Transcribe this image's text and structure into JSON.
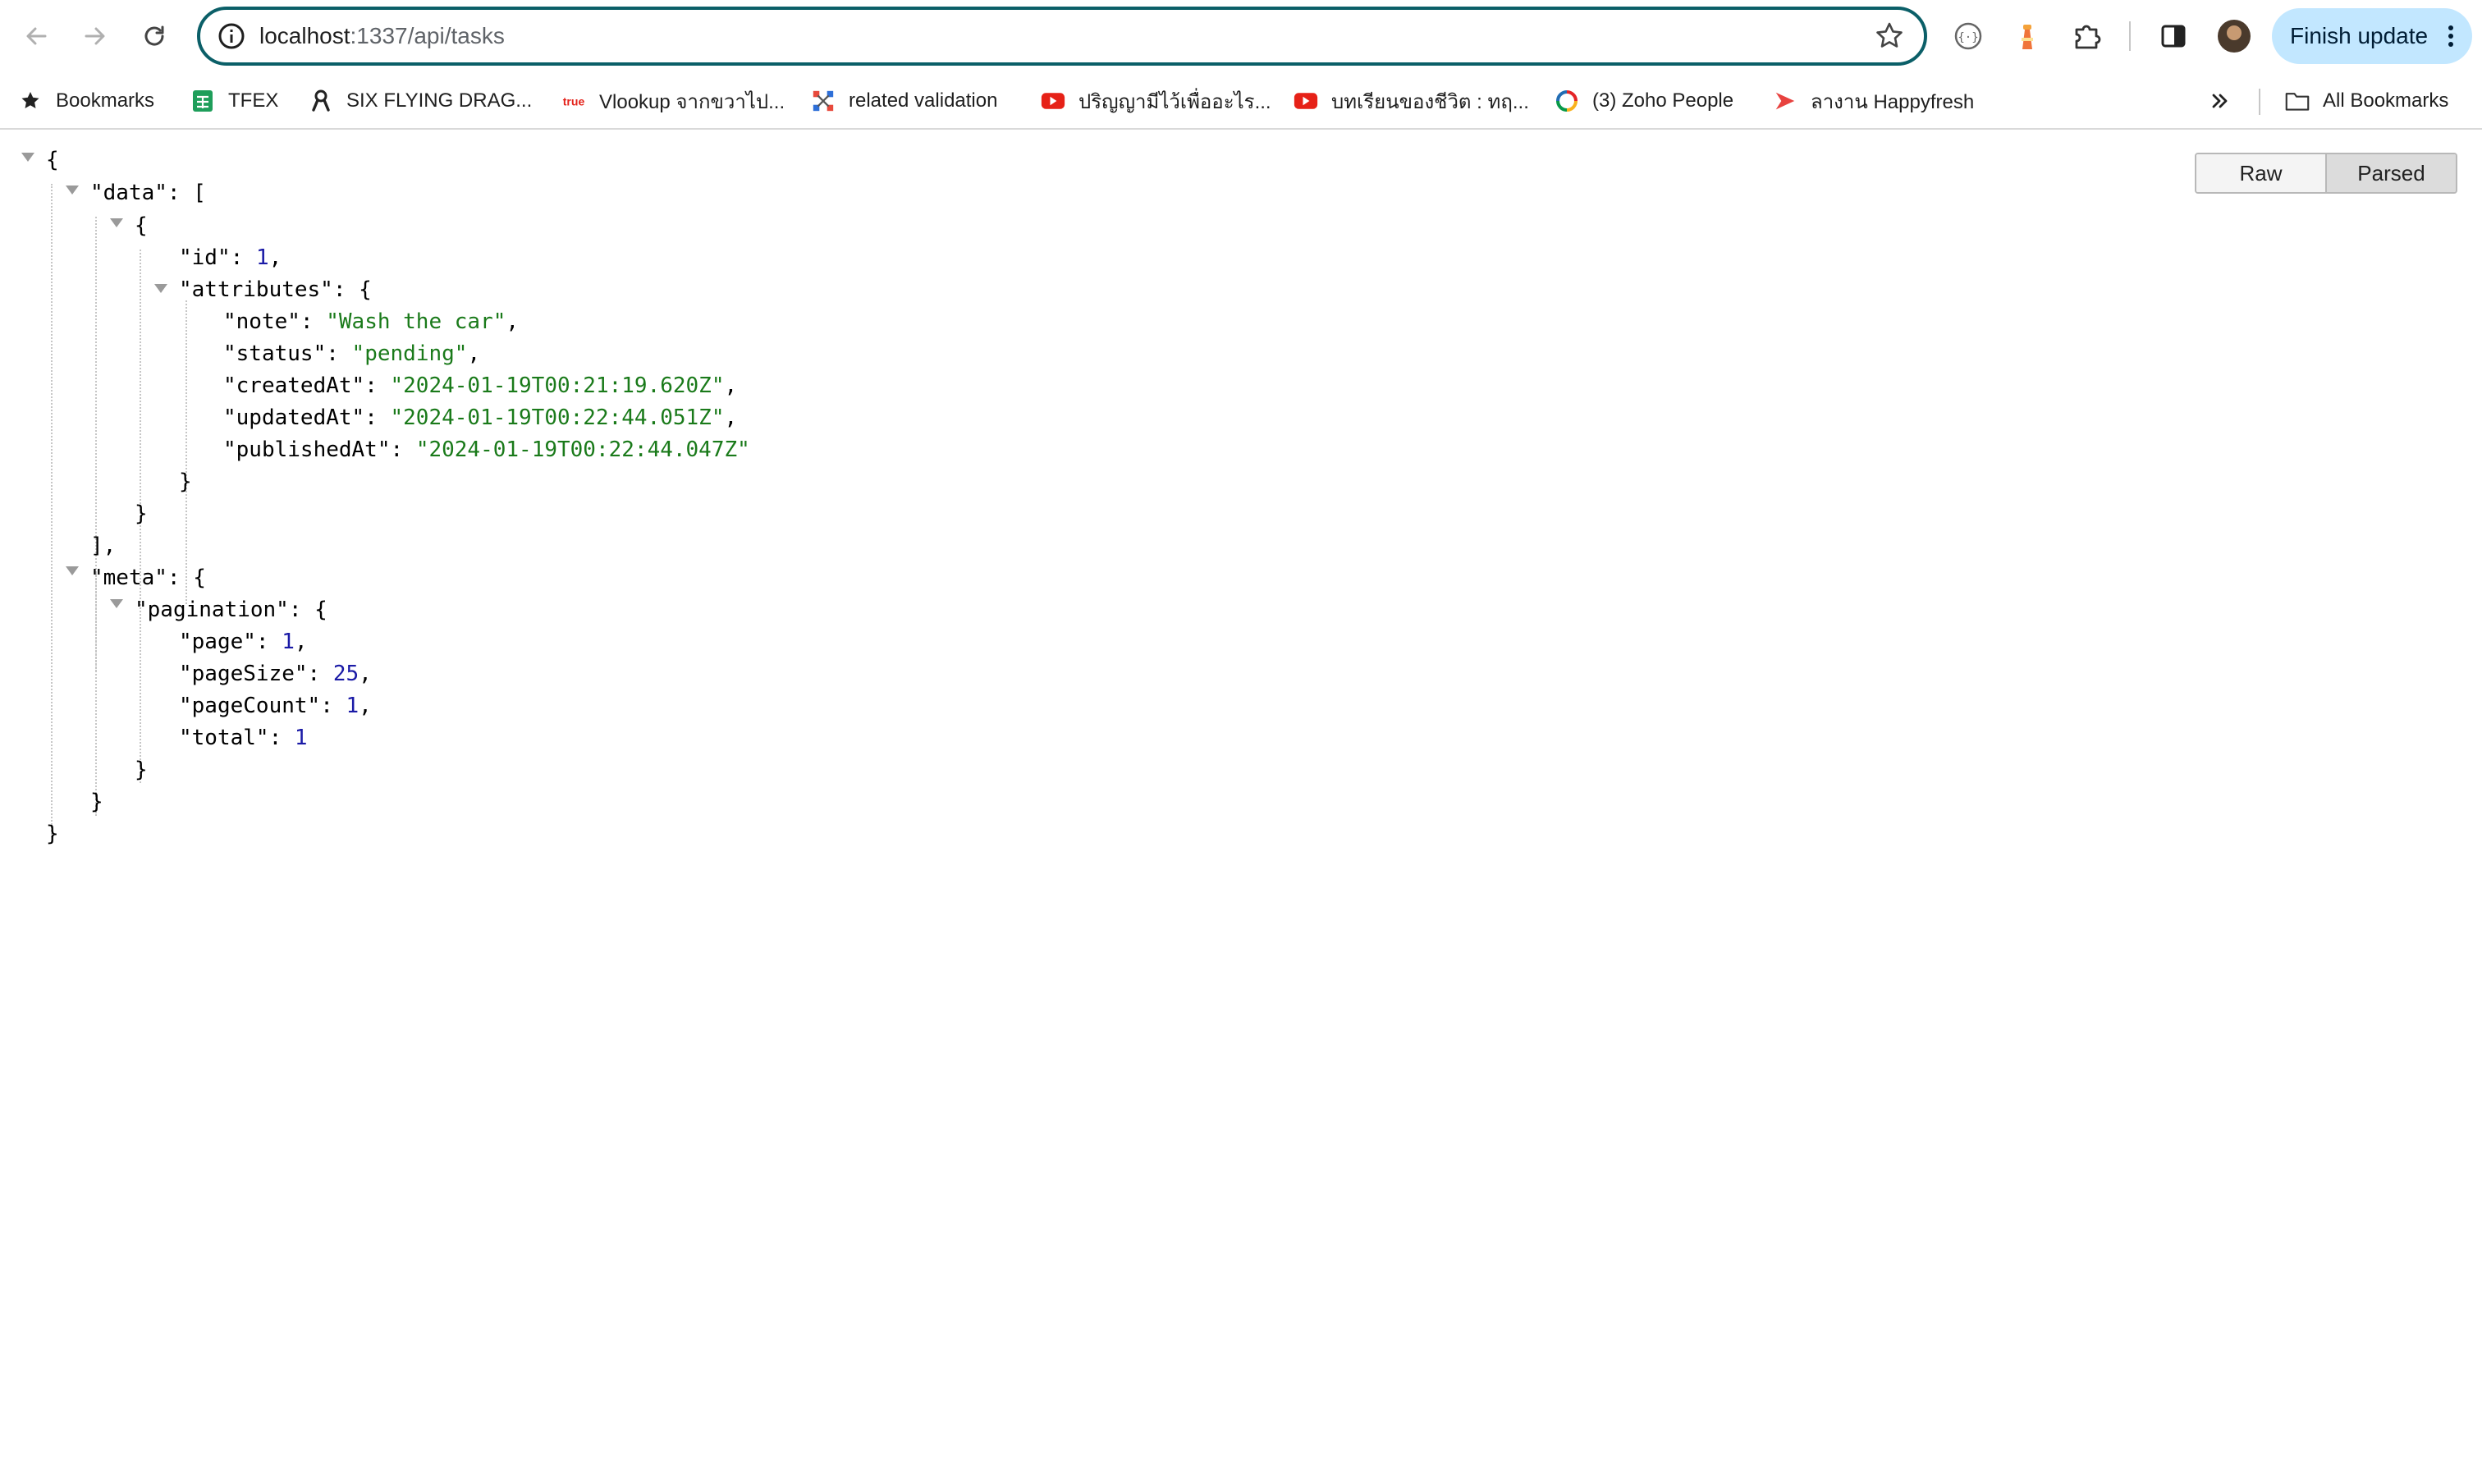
{
  "browser": {
    "url_host": "localhost",
    "url_path": ":1337/api/tasks",
    "finish_update": "Finish update"
  },
  "bookmarks": [
    {
      "label": "Bookmarks",
      "icon": "star-icon"
    },
    {
      "label": "TFEX",
      "icon": "sheets-icon"
    },
    {
      "label": "SIX FLYING DRAG...",
      "icon": "ribbon-icon"
    },
    {
      "label": "Vlookup จากขวาไป...",
      "icon": "true-logo-icon"
    },
    {
      "label": "related validation",
      "icon": "network-icon"
    },
    {
      "label": "ปริญญามีไว้เพื่ออะไร...",
      "icon": "youtube-icon"
    },
    {
      "label": "บทเรียนของชีวิต : ทฤ...",
      "icon": "youtube-icon"
    },
    {
      "label": "(3) Zoho People",
      "icon": "zoho-icon"
    },
    {
      "label": "ลางาน Happyfresh",
      "icon": "happyfresh-icon"
    }
  ],
  "all_bookmarks": "All Bookmarks",
  "viewer": {
    "raw": "Raw",
    "parsed": "Parsed"
  },
  "json": {
    "data": [
      {
        "id": "1",
        "attributes": {
          "note": "\"Wash the car\"",
          "status": "\"pending\"",
          "createdAt": "\"2024-01-19T00:21:19.620Z\"",
          "updatedAt": "\"2024-01-19T00:22:44.051Z\"",
          "publishedAt": "\"2024-01-19T00:22:44.047Z\""
        }
      }
    ],
    "meta": {
      "pagination": {
        "page": "1",
        "pageSize": "25",
        "pageCount": "1",
        "total": "1"
      }
    }
  },
  "json_keys": {
    "data": "\"data\"",
    "id": "\"id\"",
    "attributes": "\"attributes\"",
    "note": "\"note\"",
    "status": "\"status\"",
    "createdAt": "\"createdAt\"",
    "updatedAt": "\"updatedAt\"",
    "publishedAt": "\"publishedAt\"",
    "meta": "\"meta\"",
    "pagination": "\"pagination\"",
    "page": "\"page\"",
    "pageSize": "\"pageSize\"",
    "pageCount": "\"pageCount\"",
    "total": "\"total\""
  },
  "colors": {
    "string": "#1a7a1a",
    "number": "#1a1aa6",
    "omnibox_border": "#0b5f68",
    "finish_button": "#c2e7ff"
  }
}
